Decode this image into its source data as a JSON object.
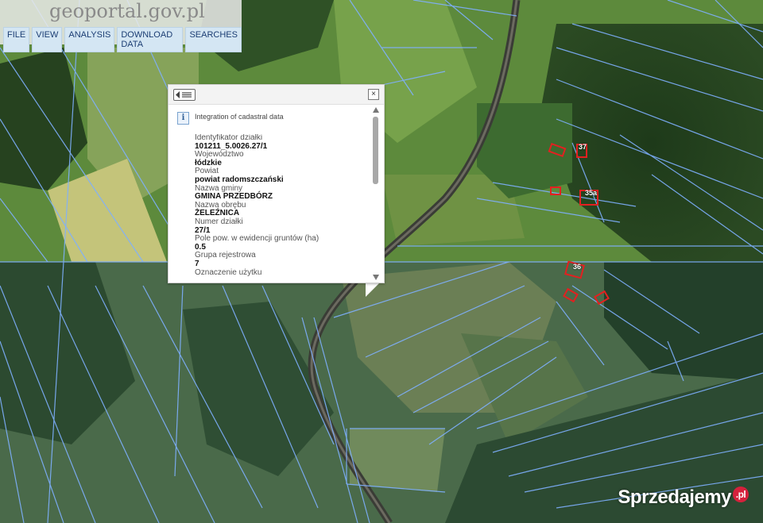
{
  "app": {
    "logo_text": "geoportal.gov.pl",
    "menu": [
      "FILE",
      "VIEW",
      "ANALYSIS",
      "DOWNLOAD DATA",
      "SEARCHES"
    ]
  },
  "popup": {
    "title": "Integration of cadastral data",
    "close_label": "×",
    "info_glyph": "i",
    "fields": [
      {
        "label": "Identyfikator działki",
        "value": "101211_5.0026.27/1"
      },
      {
        "label": "Województwo",
        "value": "łódzkie"
      },
      {
        "label": "Powiat",
        "value": "powiat radomszczański"
      },
      {
        "label": "Nazwa gminy",
        "value": "GMINA PRZEDBÓRZ"
      },
      {
        "label": "Nazwa obrębu",
        "value": "ŻELEŹNICA"
      },
      {
        "label": "Numer działki",
        "value": "27/1"
      },
      {
        "label": "Pole pow. w ewidencji gruntów (ha)",
        "value": "0.5"
      },
      {
        "label": "Grupa rejestrowa",
        "value": "7"
      },
      {
        "label": "Oznaczenie użytku",
        "value": ""
      }
    ]
  },
  "map": {
    "parcel_labels": [
      "37",
      "35a",
      "36"
    ]
  },
  "watermark": {
    "text": "Sprzedajemy",
    "suffix": ".pl"
  },
  "colors": {
    "menu_bg": "#d4e6f3",
    "menu_text": "#1b3d73",
    "parcel_line": "#7fb0ff",
    "building_outline": "#e32020"
  }
}
